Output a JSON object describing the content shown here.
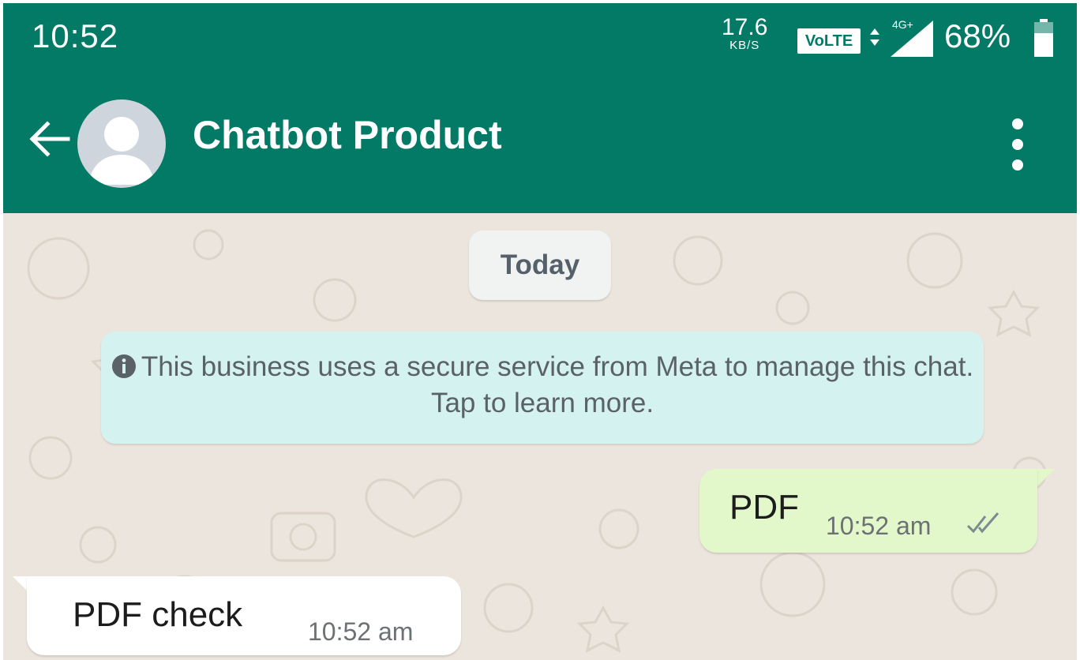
{
  "status_bar": {
    "time": "10:52",
    "speed_value": "17.6",
    "speed_unit": "KB/S",
    "volte_label": "VoLTE",
    "network": "4G+",
    "battery_percent": "68%",
    "battery_level": 0.68,
    "icons": [
      "volte-icon",
      "data-arrows-icon",
      "signal-icon",
      "battery-icon"
    ]
  },
  "app_bar": {
    "contact_name": "Chatbot Product",
    "icons": [
      "back-arrow-icon",
      "avatar-placeholder-icon",
      "more-vert-icon"
    ]
  },
  "chat": {
    "date_chip": "Today",
    "notice": "This business uses a secure service from Meta to manage this chat. Tap to learn more.",
    "messages": [
      {
        "direction": "outgoing",
        "text": "PDF",
        "time": "10:52 am",
        "status": "read-double-check"
      },
      {
        "direction": "incoming",
        "text": "PDF check",
        "time": "10:52 am"
      }
    ]
  },
  "colors": {
    "header_green": "#027a65",
    "chat_background": "#ece5dd",
    "outgoing_bubble": "#e2f8cb",
    "incoming_bubble": "#ffffff",
    "notice_bubble": "#d4f2ef",
    "date_chip": "#f1f3f3"
  }
}
